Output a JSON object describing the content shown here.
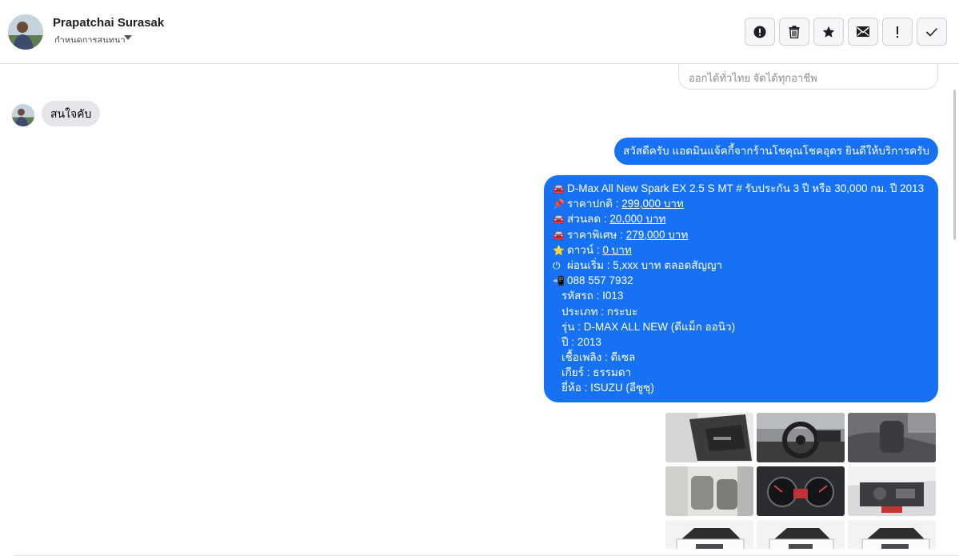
{
  "contact": {
    "name": "Prapatchai Surasak",
    "subtitle": "กำหนดการสนทนา"
  },
  "toolbar": {
    "buttons": [
      {
        "name": "alert-button",
        "icon": "alert-circle-icon"
      },
      {
        "name": "delete-button",
        "icon": "trash-icon"
      },
      {
        "name": "star-button",
        "icon": "star-icon"
      },
      {
        "name": "mail-button",
        "icon": "envelope-icon"
      },
      {
        "name": "important-button",
        "icon": "exclamation-icon"
      },
      {
        "name": "done-button",
        "icon": "check-icon"
      }
    ]
  },
  "conversation": {
    "previous_card_text": "ออกได้ทั่วไทย จัดได้ทุกอาชีพ",
    "incoming_message": "สนใจคับ",
    "greeting_message": "สวัสดีครับ แอดมินแจ้คกี้จากร้านโชคุณโชคอุดร ยินดีให้บริการครับ",
    "details": {
      "title_emoji": "🚘",
      "title": "D-Max All New Spark EX 2.5 S MT # รับประกัน 3 ปี หรือ 30,000 กม. ปี 2013",
      "price_label": "ราคาปกติ : ",
      "price_emoji": "📌",
      "price_value": "299,000 บาท",
      "discount_label": "ส่วนลด : ",
      "discount_emoji": "🚘",
      "discount_value": "20,000 บาท",
      "special_label": "ราคาพิเศษ : ",
      "special_emoji": "🚘",
      "special_value": "279,000 บาท",
      "down_label": "ดาวน์ : ",
      "down_emoji": "⭐",
      "down_value": "0 บาท",
      "installment_emoji": "⏻",
      "installment": "ผ่อนเริ่ม : 5,xxx บาท ตลอดสัญญา",
      "phone_emoji": "📲",
      "phone": "088 557 7932",
      "code": "รหัสรถ : I013",
      "type": "ประเภท : กระบะ",
      "model": "รุ่น : D-MAX ALL NEW (ดีแม็ก ออนิว)",
      "year": "ปี : 2013",
      "fuel": "เชื้อเพลิง : ดีเซล",
      "gear": "เกียร์ : ธรรมดา",
      "brand": "ยี่ห้อ : ISUZU (อีซูซุ)"
    },
    "photos": [
      "door-interior-photo",
      "steering-wheel-photo",
      "seat-photo",
      "cabin-seats-photo",
      "dashboard-gauge-photo",
      "engine-bay-photo",
      "front-view-photo-1",
      "front-view-photo-2",
      "front-view-photo-3"
    ]
  },
  "colors": {
    "outgoing_bubble": "#1672f3",
    "incoming_bubble": "#e4e6eb",
    "border": "#dcdfe3"
  }
}
